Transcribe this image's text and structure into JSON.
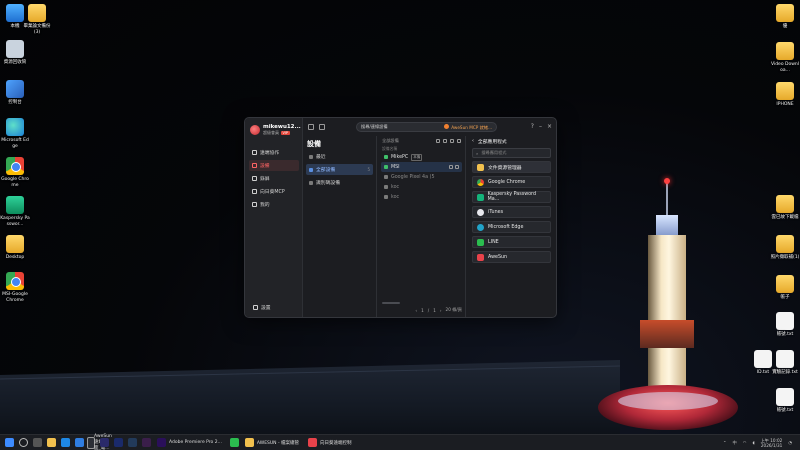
{
  "desktop_left": [
    {
      "label": "本機",
      "icon": "monitor-icon"
    },
    {
      "label": "畢業論文備份(3)",
      "icon": "folder-icon"
    },
    {
      "label": "資源回收筒",
      "icon": "recycle-bin-icon"
    },
    {
      "label": "控制台",
      "icon": "control-panel-icon"
    },
    {
      "label": "Microsoft Edge",
      "icon": "edge-icon"
    },
    {
      "label": "Google Chrome",
      "icon": "chrome-icon"
    },
    {
      "label": "Kaspersky Passwor...",
      "icon": "kaspersky-icon"
    },
    {
      "label": "Desktop",
      "icon": "folder-icon"
    },
    {
      "label": "MSI-Google Chrome",
      "icon": "chrome-icon"
    }
  ],
  "desktop_right": [
    {
      "label": "優",
      "icon": "folder-icon"
    },
    {
      "label": "Video Downloa...",
      "icon": "folder-icon"
    },
    {
      "label": "IPHONE",
      "icon": "folder-icon"
    },
    {
      "label": "雲已故下載檔",
      "icon": "folder-icon"
    },
    {
      "label": "照片擷取補(1)",
      "icon": "folder-icon"
    },
    {
      "label": "帳子",
      "icon": "folder-icon"
    },
    {
      "label": "帳號.txt",
      "icon": "document-icon"
    },
    {
      "label": "ID.txt",
      "icon": "document-icon"
    },
    {
      "label": "實驗記錄.txt",
      "icon": "document-icon"
    },
    {
      "label": "帳號.txt",
      "icon": "document-icon"
    }
  ],
  "app": {
    "user": {
      "name": "mikewu12...",
      "sub": "超級會員",
      "badge": "VIP"
    },
    "nav": [
      {
        "label": "遠端協作",
        "active": false
      },
      {
        "label": "設備",
        "active": true
      },
      {
        "label": "錄屏",
        "active": false
      },
      {
        "label": "向日葵MCP",
        "active": false
      },
      {
        "label": "我的",
        "active": false
      }
    ],
    "settings_label": "設置",
    "search_placeholder": "搜尋/連線設備",
    "promo_text": "AweSun MCP 就緒...",
    "title": "設備",
    "groups": [
      {
        "label": "最近",
        "count": "",
        "selected": false
      },
      {
        "label": "全部設備",
        "count": "5",
        "selected": true
      },
      {
        "label": "識別碼設備",
        "count": "",
        "selected": false
      }
    ],
    "device_list_title": "全部設備",
    "device_list_sub": "設備名稱",
    "devices": [
      {
        "name": "MikePC",
        "tag": "本機",
        "online": true,
        "selected": false
      },
      {
        "name": "MSI",
        "tag": "",
        "online": true,
        "selected": true
      },
      {
        "name": "Google Pixel 4a (5",
        "tag": "",
        "online": false,
        "selected": false
      },
      {
        "name": "koc",
        "tag": "",
        "online": false,
        "selected": false
      },
      {
        "name": "koc",
        "tag": "",
        "online": false,
        "selected": false
      }
    ],
    "pager": {
      "page": "1",
      "sep": "/",
      "total": "1",
      "per_page": "20 條/頁"
    },
    "apps_title": "全部應用程式",
    "apps_search_placeholder": "搜尋應用程式",
    "apps": [
      {
        "name": "文件資源管理器",
        "color": "#f2c14e",
        "selected": true
      },
      {
        "name": "Google Chrome",
        "color": "#e94235",
        "selected": false
      },
      {
        "name": "Kaspersky Password Ma...",
        "color": "#14b37a",
        "selected": false
      },
      {
        "name": "iTunes",
        "color": "#e8e8ee",
        "selected": false
      },
      {
        "name": "Microsoft Edge",
        "color": "#21a3c9",
        "selected": false
      },
      {
        "name": "LINE",
        "color": "#2bbd4f",
        "selected": false
      },
      {
        "name": "AweSun",
        "color": "#e8424a",
        "selected": false
      }
    ]
  },
  "taskbar": {
    "buttons": [
      {
        "label": "AweSun遠端桌面_電...",
        "active": true
      },
      {
        "label": "Adobe Premiere Pro 2...",
        "active": false
      },
      {
        "label": "AWESUN - 檔案總管",
        "active": false
      },
      {
        "label": "向日葵遠端控制",
        "active": false
      }
    ],
    "tray_lang": "中",
    "time": "上午 10:02",
    "date": "2026/1/31"
  }
}
